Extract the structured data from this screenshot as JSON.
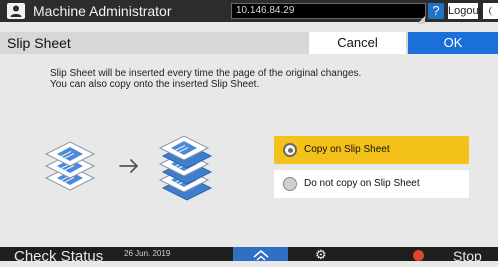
{
  "topbar": {
    "user_label": "Machine Administrator",
    "ip": "10.146.84.29",
    "help_label": "?",
    "logout_label": "Logout"
  },
  "titlebar": {
    "title": "Slip Sheet",
    "cancel_label": "Cancel",
    "ok_label": "OK"
  },
  "description": {
    "line1": "Slip Sheet will be inserted every time the page of the original changes.",
    "line2": "You can also copy onto the inserted Slip Sheet."
  },
  "options": [
    {
      "label": "Copy on Slip Sheet",
      "selected": true
    },
    {
      "label": "Do not copy on Slip Sheet",
      "selected": false
    }
  ],
  "bottombar": {
    "check_status_label": "Check Status",
    "date": "26 Jun. 2019",
    "stop_label": "Stop"
  },
  "colors": {
    "accent_blue": "#1b6fd8",
    "selected_yellow": "#f3c11a",
    "stop_red": "#e0442b"
  },
  "icons": [
    "user-icon",
    "help-icon",
    "moon-icon",
    "home-icon",
    "gear-icon",
    "stop-icon"
  ]
}
